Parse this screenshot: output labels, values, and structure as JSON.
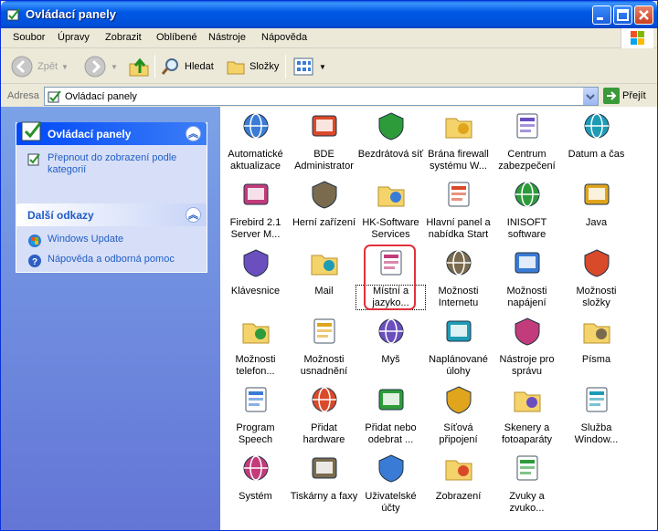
{
  "window": {
    "title": "Ovládací panely"
  },
  "menu": [
    "Soubor",
    "Úpravy",
    "Zobrazit",
    "Oblíbené",
    "Nástroje",
    "Nápověda"
  ],
  "toolbar": {
    "back": "Zpět",
    "search": "Hledat",
    "folders": "Složky"
  },
  "address": {
    "label": "Adresa",
    "value": "Ovládací panely",
    "go": "Přejít"
  },
  "sidebar": {
    "control_panel": {
      "title": "Ovládací panely",
      "switch_link": "Přepnout do zobrazení podle kategorií"
    },
    "see_also": {
      "title": "Další odkazy",
      "links": [
        "Windows Update",
        "Nápověda a odborná pomoc"
      ]
    }
  },
  "items": [
    {
      "label": "Automatické aktualizace",
      "icon": "globe-shield-icon"
    },
    {
      "label": "BDE Administrator",
      "icon": "bde-gear-icon"
    },
    {
      "label": "Bezdrátová síť",
      "icon": "wireless-icon"
    },
    {
      "label": "Brána firewall systému W...",
      "icon": "firewall-icon"
    },
    {
      "label": "Centrum zabezpečení",
      "icon": "shield-icon"
    },
    {
      "label": "Datum a čas",
      "icon": "clock-icon"
    },
    {
      "label": "Firebird 2.1 Server M...",
      "icon": "firebird-icon"
    },
    {
      "label": "Herní zařízení",
      "icon": "gamepad-icon"
    },
    {
      "label": "HK-Software Services",
      "icon": "hk-software-icon"
    },
    {
      "label": "Hlavní panel a nabídka Start",
      "icon": "taskbar-icon"
    },
    {
      "label": "INISOFT software",
      "icon": "inisoft-icon"
    },
    {
      "label": "Java",
      "icon": "java-icon"
    },
    {
      "label": "Klávesnice",
      "icon": "keyboard-icon"
    },
    {
      "label": "Mail",
      "icon": "mail-icon"
    },
    {
      "label": "Místní a jazyko...",
      "icon": "globe-icon"
    },
    {
      "label": "Možnosti Internetu",
      "icon": "internet-options-icon"
    },
    {
      "label": "Možnosti napájení",
      "icon": "power-icon"
    },
    {
      "label": "Možnosti složky",
      "icon": "folder-options-icon"
    },
    {
      "label": "Možnosti telefon...",
      "icon": "phone-icon"
    },
    {
      "label": "Možnosti usnadnění",
      "icon": "accessibility-icon"
    },
    {
      "label": "Myš",
      "icon": "mouse-icon"
    },
    {
      "label": "Naplánované úlohy",
      "icon": "scheduled-tasks-icon"
    },
    {
      "label": "Nástroje pro správu",
      "icon": "admin-tools-icon"
    },
    {
      "label": "Písma",
      "icon": "fonts-icon"
    },
    {
      "label": "Program Speech",
      "icon": "speech-icon"
    },
    {
      "label": "Přidat hardware",
      "icon": "add-hardware-icon"
    },
    {
      "label": "Přidat nebo odebrat ...",
      "icon": "add-remove-icon"
    },
    {
      "label": "Síťová připojení",
      "icon": "network-icon"
    },
    {
      "label": "Skenery a fotoaparáty",
      "icon": "scanner-icon"
    },
    {
      "label": "Služba Window...",
      "icon": "cardspace-icon"
    },
    {
      "label": "Systém",
      "icon": "system-icon"
    },
    {
      "label": "Tiskárny a faxy",
      "icon": "printer-icon"
    },
    {
      "label": "Uživatelské účty",
      "icon": "users-icon"
    },
    {
      "label": "Zobrazení",
      "icon": "display-icon"
    },
    {
      "label": "Zvuky a zvuko...",
      "icon": "sound-icon"
    }
  ]
}
